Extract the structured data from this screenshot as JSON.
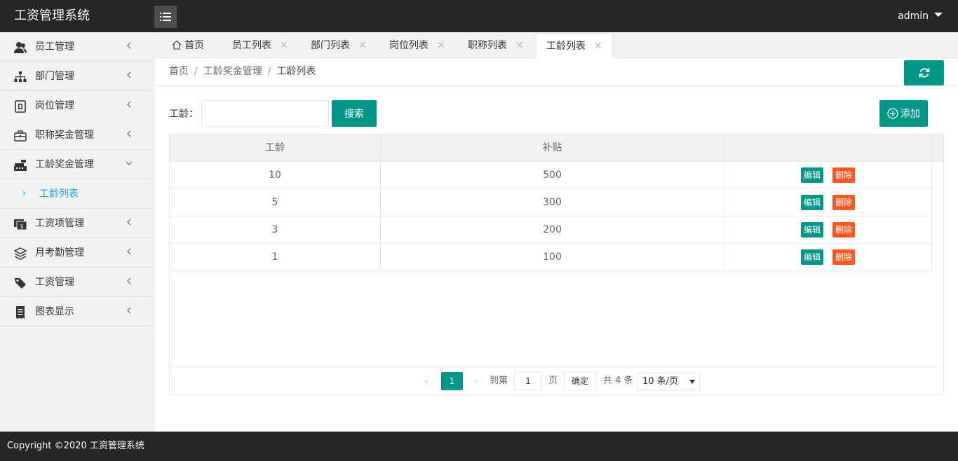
{
  "header": {
    "brand": "工资管理系统",
    "menu_toggle_icon": "list-icon",
    "user": "admin"
  },
  "sidebar": {
    "items": [
      {
        "label": "员工管理",
        "icon": "users-icon",
        "expanded": false
      },
      {
        "label": "部门管理",
        "icon": "sitemap-icon",
        "expanded": false
      },
      {
        "label": "岗位管理",
        "icon": "badge-icon",
        "expanded": false
      },
      {
        "label": "职称奖金管理",
        "icon": "briefcase-icon",
        "expanded": false
      },
      {
        "label": "工龄奖金管理",
        "icon": "cash-register-icon",
        "expanded": true
      },
      {
        "label": "工资项管理",
        "icon": "money-icon",
        "expanded": false
      },
      {
        "label": "月考勤管理",
        "icon": "layers-icon",
        "expanded": false
      },
      {
        "label": "工资管理",
        "icon": "tag-icon",
        "expanded": false
      },
      {
        "label": "图表显示",
        "icon": "receipt-icon",
        "expanded": false
      }
    ],
    "sub_items": [
      {
        "label": "工龄列表",
        "parent": "工龄奖金管理",
        "active": true
      }
    ]
  },
  "tabs": [
    {
      "label": "首页",
      "closable": false,
      "active": false,
      "icon": "home-icon"
    },
    {
      "label": "员工列表",
      "closable": true,
      "active": false
    },
    {
      "label": "部门列表",
      "closable": true,
      "active": false
    },
    {
      "label": "岗位列表",
      "closable": true,
      "active": false
    },
    {
      "label": "职称列表",
      "closable": true,
      "active": false
    },
    {
      "label": "工龄列表",
      "closable": true,
      "active": true
    }
  ],
  "tab_close_glyph": "✕",
  "breadcrumb": {
    "items": [
      "首页",
      "工龄奖金管理",
      "工龄列表"
    ],
    "separator": "/"
  },
  "search": {
    "label": "工龄：",
    "value": "",
    "placeholder": "",
    "button": "搜索"
  },
  "add_button": "添加",
  "table": {
    "columns": [
      "工龄",
      "补贴",
      ""
    ],
    "rows": [
      {
        "seniority": "10",
        "allowance": "500"
      },
      {
        "seniority": "5",
        "allowance": "300"
      },
      {
        "seniority": "3",
        "allowance": "200"
      },
      {
        "seniority": "1",
        "allowance": "100"
      }
    ],
    "row_actions": {
      "edit": "编辑",
      "delete": "删除"
    }
  },
  "pager": {
    "prev": "‹",
    "next": "›",
    "current_page": "1",
    "goto_label": "到第",
    "goto_value": "1",
    "page_unit": "页",
    "confirm": "确定",
    "total": "共 4 条",
    "page_size": "10 条/页"
  },
  "footer": {
    "copyright": "Copyright ©2020 工资管理系统"
  },
  "colors": {
    "primary": "#009688",
    "danger": "#ff5722",
    "header_bg": "#262626",
    "sidebar_bg": "#f2f2f2",
    "active_link": "#1e9fff"
  }
}
